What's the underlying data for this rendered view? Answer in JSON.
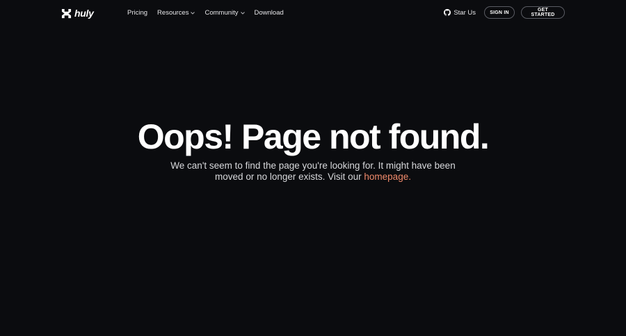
{
  "header": {
    "logo_text": "huly",
    "nav": [
      {
        "label": "Pricing",
        "has_dropdown": false
      },
      {
        "label": "Resources",
        "has_dropdown": true
      },
      {
        "label": "Community",
        "has_dropdown": true
      },
      {
        "label": "Download",
        "has_dropdown": false
      }
    ],
    "star_label": "Star Us",
    "sign_in_label": "SIGN IN",
    "get_started_label": "GET STARTED"
  },
  "main": {
    "title": "Oops! Page not found.",
    "message_line1": "We can't seem to find the page you're looking for. It might have been moved",
    "message_line2_prefix": "or no longer exists. Visit our ",
    "homepage_link": "homepage",
    "message_suffix": "."
  },
  "colors": {
    "background": "#0b0c0f",
    "text": "#ffffff",
    "accent": "#f08a6b",
    "button_border": "#5a5c63"
  },
  "icons": {
    "logo": "huly-logo-icon",
    "github": "github-icon",
    "dropdown": "chevron-down-icon"
  }
}
